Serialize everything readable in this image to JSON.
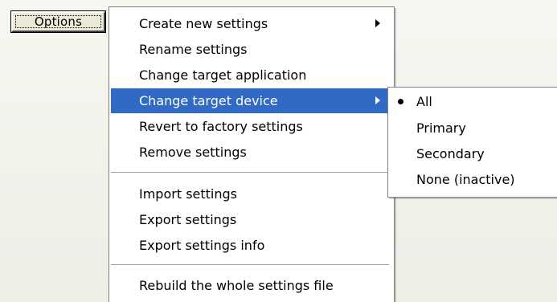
{
  "options_button": {
    "label": "Options"
  },
  "main_menu": {
    "items": [
      {
        "label": "Create new settings",
        "has_submenu": true
      },
      {
        "label": "Rename settings"
      },
      {
        "label": "Change target application"
      },
      {
        "label": "Change target device",
        "has_submenu": true,
        "highlighted": true
      },
      {
        "label": "Revert to factory settings"
      },
      {
        "label": "Remove settings"
      },
      {
        "label": "Import settings"
      },
      {
        "label": "Export settings"
      },
      {
        "label": "Export settings info"
      },
      {
        "label": "Rebuild the whole settings file"
      }
    ]
  },
  "sub_menu": {
    "items": [
      {
        "label": "All",
        "selected": true
      },
      {
        "label": "Primary"
      },
      {
        "label": "Secondary"
      },
      {
        "label": "None (inactive)"
      }
    ]
  },
  "colors": {
    "highlight": "#316ac5",
    "menu_background": "#ffffff",
    "button_face": "#ece9d8"
  },
  "icons": {
    "submenu_arrow": "chevron-right-icon",
    "selected_marker": "bullet-icon"
  }
}
